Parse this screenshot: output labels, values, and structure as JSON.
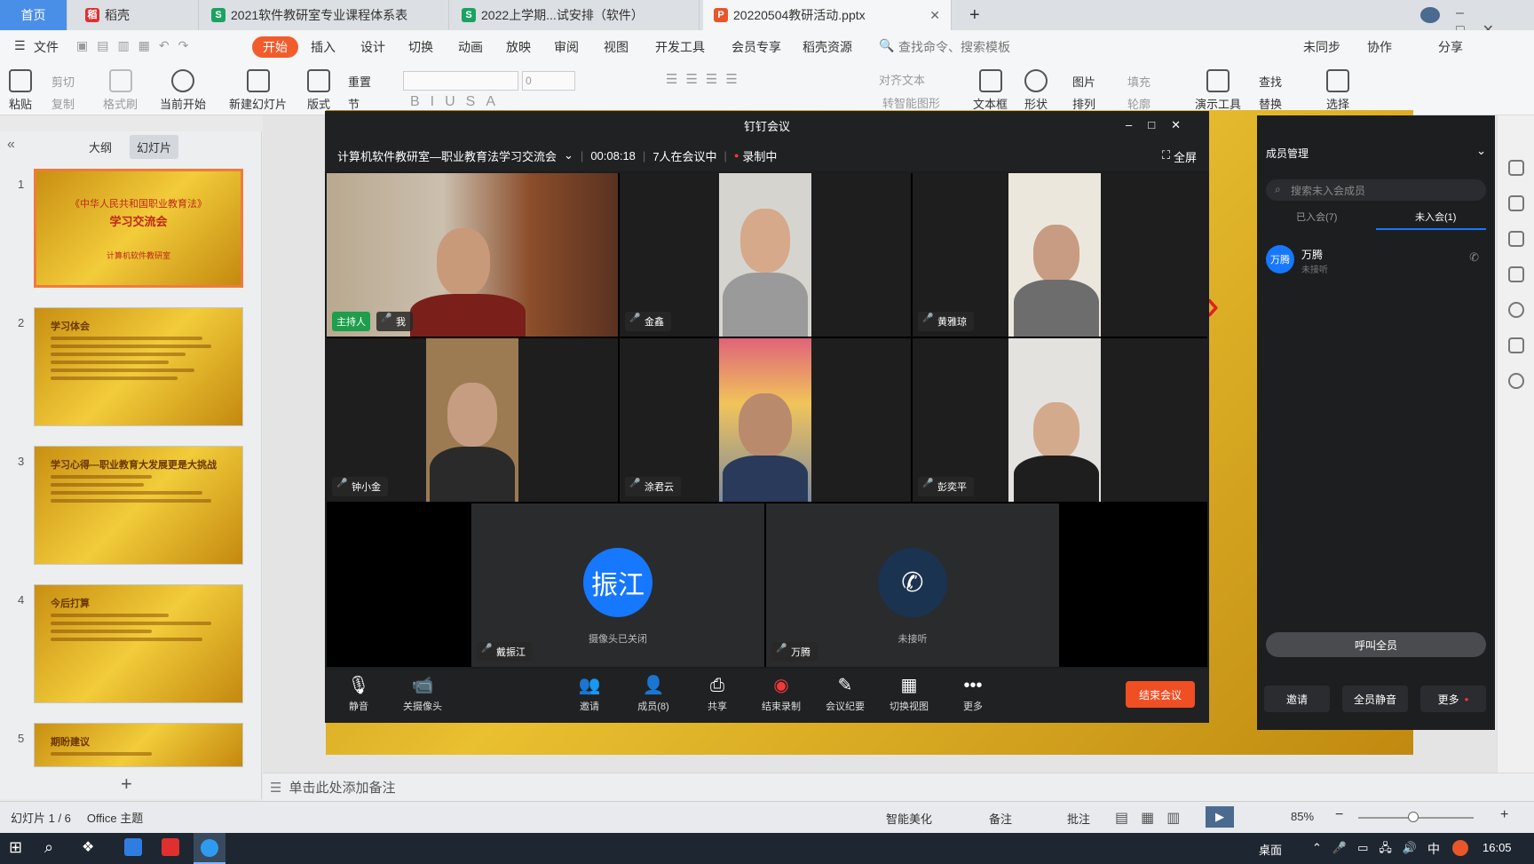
{
  "tabs": {
    "home": "首页",
    "t1": "稻壳",
    "t2": "2021软件教研室专业课程体系表",
    "t3": "2022上学期...试安排（软件）",
    "t4": "20220504教研活动.pptx",
    "new": "+"
  },
  "menu": {
    "file": "文件",
    "start": "开始",
    "insert": "插入",
    "design": "设计",
    "switch": "切换",
    "anim": "动画",
    "show": "放映",
    "review": "审阅",
    "view": "视图",
    "dev": "开发工具",
    "vip": "会员专享",
    "docer": "稻壳资源",
    "search": "查找命令、搜索模板",
    "sync": "未同步",
    "collab": "协作",
    "share": "分享"
  },
  "ribbon": {
    "paste": "粘贴",
    "cut": "剪切",
    "copy": "复制",
    "format": "格式刷",
    "play_from": "当前开始",
    "new_slide": "新建幻灯片",
    "layout": "版式",
    "section": "节",
    "reset": "重置",
    "font_size": "0",
    "align_text": "对齐文本",
    "to_smartart": "转智能图形",
    "textbox": "文本框",
    "shape": "形状",
    "arrange": "排列",
    "picture": "图片",
    "fill": "填充",
    "outline": "轮廓",
    "present": "演示工具",
    "find": "查找",
    "replace": "替换",
    "select": "选择"
  },
  "panes": {
    "outline": "大纲",
    "slides": "幻灯片"
  },
  "slides": [
    {
      "num": "1",
      "title": "《中华人民共和国职业教育法》",
      "sub": "学习交流会",
      "foot": "计算机软件教研室"
    },
    {
      "num": "2",
      "title": "学习体会"
    },
    {
      "num": "3",
      "title": "学习心得—职业教育大发展更是大挑战"
    },
    {
      "num": "4",
      "title": "今后打算"
    },
    {
      "num": "5",
      "title": "期盼建议"
    }
  ],
  "meeting": {
    "window_title": "钉钉会议",
    "meeting_name": "计算机软件教研室—职业教育法学习交流会",
    "duration": "00:08:18",
    "count": "7人在会议中",
    "recording": "录制中",
    "fullscreen": "全屏",
    "host_tag": "主持人",
    "participants": [
      "我",
      "金鑫",
      "黄雅琼",
      "钟小金",
      "涂君云",
      "彭奕平",
      "戴振江",
      "万腾"
    ],
    "avatar1": "振江",
    "avatar1_status": "摄像头已关闭",
    "avatar2_status": "未接听",
    "toolbar": [
      "静音",
      "关摄像头",
      "邀请",
      "成员(8)",
      "共享",
      "结束录制",
      "会议纪要",
      "切换视图",
      "更多"
    ],
    "end": "结束会议"
  },
  "members": {
    "title": "成员管理",
    "search": "搜索未入会成员",
    "tab_in": "已入会(7)",
    "tab_out": "未入会(1)",
    "name": "万腾",
    "avatar": "万腾",
    "status": "未接听",
    "call_all": "呼叫全员",
    "invite": "邀请",
    "mute_all": "全员静音",
    "more": "更多"
  },
  "notes": "单击此处添加备注",
  "status": {
    "slide": "幻灯片 1 / 6",
    "theme": "Office 主题",
    "beautify": "智能美化",
    "remarks": "备注",
    "comment": "批注",
    "zoom": "85%"
  },
  "taskbar": {
    "desktop": "桌面",
    "ime": "中",
    "time": "16:05"
  }
}
